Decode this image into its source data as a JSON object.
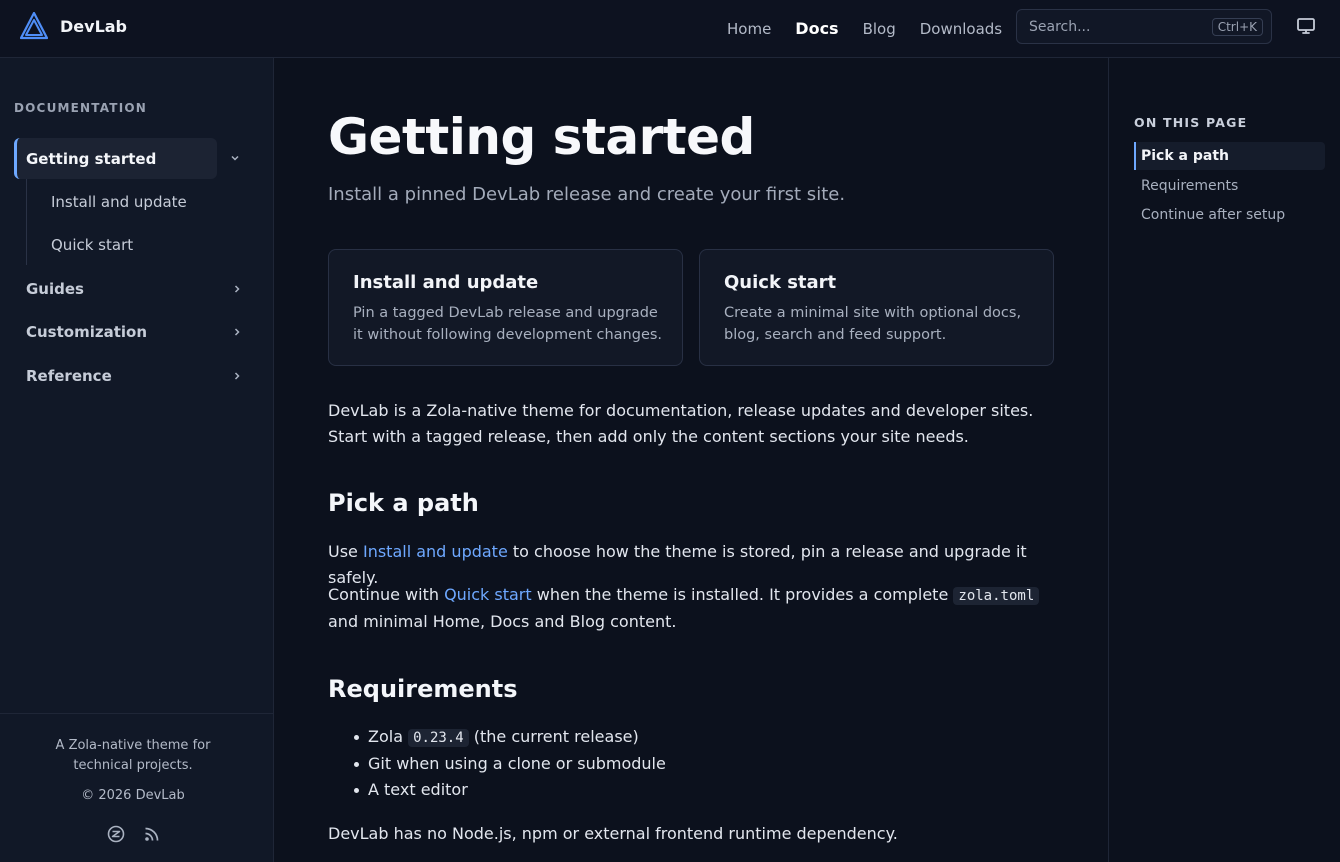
{
  "header": {
    "brand_name": "DevLab",
    "nav": [
      "Home",
      "Docs",
      "Blog",
      "Downloads"
    ],
    "search_placeholder": "Search...",
    "search_shortcut": "Ctrl+K",
    "active_nav": "Docs"
  },
  "sidebar": {
    "heading": "DOCUMENTATION",
    "active_item": "Getting started",
    "sub_items": [
      "Install and update",
      "Quick start"
    ],
    "items": [
      "Guides",
      "Customization",
      "Reference"
    ],
    "tagline": "A Zola-native theme for technical projects.",
    "copyright": "© 2026 DevLab"
  },
  "main": {
    "title": "Getting started",
    "subtitle": "Install a pinned DevLab release and create your first site.",
    "cards": [
      {
        "title": "Install and update",
        "text": "Pin a tagged DevLab release and upgrade it without following development changes."
      },
      {
        "title": "Quick start",
        "text": "Create a minimal site with optional docs, blog, search and feed support."
      }
    ],
    "intro": "DevLab is a Zola-native theme for documentation, release updates and developer sites. Start with a tagged release, then add only the content sections your site needs.",
    "pick_heading": "Pick a path",
    "pick_p1_before": "Use ",
    "pick_p1_link": "Install and update",
    "pick_p1_after": " to choose how the theme is stored, pin a release and upgrade it safely.",
    "pick_p2_before": "Continue with ",
    "pick_p2_link": "Quick start",
    "pick_p2_mid": " when the theme is installed. It provides a complete ",
    "pick_p2_code": "zola.toml",
    "pick_p2_after": " and minimal Home, Docs and Blog content.",
    "req_heading": "Requirements",
    "req_1_before": "Zola ",
    "req_1_code": "0.23.4",
    "req_1_after": " (the current release)",
    "req_2": "Git when using a clone or submodule",
    "req_3": "A text editor",
    "closing": "DevLab has no Node.js, npm or external frontend runtime dependency."
  },
  "toc": {
    "heading": "ON THIS PAGE",
    "active": "Pick a path",
    "items": [
      "Requirements",
      "Continue after setup"
    ]
  },
  "colors": {
    "accent": "#6ea8ff",
    "background": "#0c111d",
    "sidebar": "#111827"
  },
  "icons": {
    "brand": "triangle-logo-icon",
    "theme": "monitor-icon",
    "chevron_down": "chevron-down-icon",
    "chevron_right": "chevron-right-icon",
    "footer": [
      "zola-icon",
      "rss-icon"
    ]
  }
}
